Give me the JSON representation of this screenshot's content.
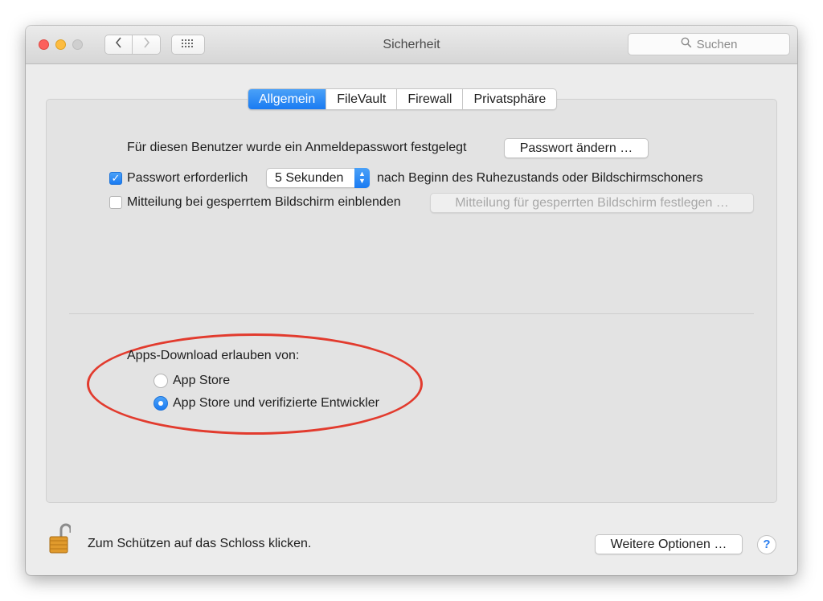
{
  "window": {
    "title": "Sicherheit"
  },
  "toolbar": {
    "back_glyph": "‹",
    "forward_glyph": "›",
    "grid_glyph": "⋮⋮⋮",
    "search_placeholder": "Suchen",
    "search_icon": "magnifier-icon"
  },
  "tabs": [
    {
      "label": "Allgemein",
      "active": true
    },
    {
      "label": "FileVault",
      "active": false
    },
    {
      "label": "Firewall",
      "active": false
    },
    {
      "label": "Privatsphäre",
      "active": false
    }
  ],
  "general": {
    "password_set_text": "Für diesen Benutzer wurde ein Anmeldepasswort festgelegt",
    "change_password_button": "Passwort ändern …",
    "require_password": {
      "checked": true,
      "label": "Passwort erforderlich",
      "delay_value": "5 Sekunden",
      "suffix": "nach Beginn des Ruhezustands oder Bildschirmschoners"
    },
    "lock_message": {
      "checked": false,
      "label": "Mitteilung bei gesperrtem Bildschirm einblenden",
      "button": "Mitteilung für gesperrten Bildschirm festlegen …"
    }
  },
  "apps_download": {
    "heading": "Apps-Download erlauben von:",
    "options": [
      {
        "label": "App Store",
        "selected": false
      },
      {
        "label": "App Store und verifizierte Entwickler",
        "selected": true
      }
    ]
  },
  "footer": {
    "lock_text": "Zum Schützen auf das Schloss klicken.",
    "more_options_button": "Weitere Optionen …",
    "help_label": "?",
    "lock_icon": "open-padlock-icon"
  },
  "colors": {
    "accent": "#1a7bf2",
    "highlight_ring": "#e23b2e"
  }
}
